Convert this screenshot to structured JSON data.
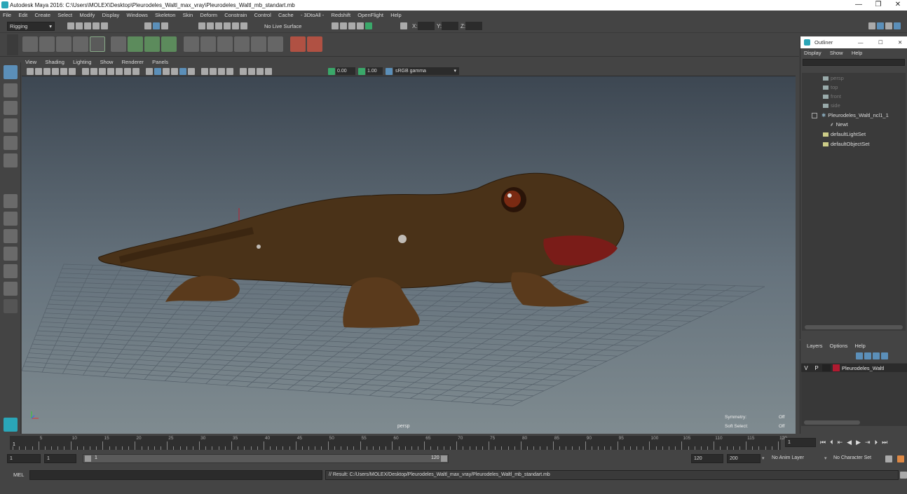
{
  "window": {
    "title": "Autodesk Maya 2016: C:\\Users\\MOLEX\\Desktop\\Pleurodeles_Waltl_max_vray\\Pleurodeles_Waltl_mb_standart.mb",
    "minimize": "—",
    "restore": "❐",
    "close": "✕"
  },
  "menu": [
    "File",
    "Edit",
    "Create",
    "Select",
    "Modify",
    "Display",
    "Windows",
    "Skeleton",
    "Skin",
    "Deform",
    "Constrain",
    "Control",
    "Cache",
    "- 3DtoAll -",
    "Redshift",
    "OpenFlight",
    "Help"
  ],
  "toolbar": {
    "mode": "Rigging",
    "live_surface": "No Live Surface",
    "x_label": "X:",
    "y_label": "Y:",
    "z_label": "Z:"
  },
  "viewport_menu": [
    "View",
    "Shading",
    "Lighting",
    "Show",
    "Renderer",
    "Panels"
  ],
  "viewport_toolbar": {
    "exposure": "0.00",
    "gamma": "1.00",
    "color_space": "sRGB gamma"
  },
  "viewport": {
    "camera": "persp",
    "symmetry_label": "Symmetry:",
    "symmetry_value": "Off",
    "soft_select_label": "Soft Select:",
    "soft_select_value": "Off"
  },
  "outliner": {
    "title": "Outliner",
    "menu": [
      "Display",
      "Show",
      "Help"
    ],
    "items": [
      "persp",
      "top",
      "front",
      "side",
      "Pleurodeles_Waltl_ncl1_1",
      "Newt",
      "defaultLightSet",
      "defaultObjectSet"
    ]
  },
  "layers": {
    "menu": [
      "Layers",
      "Options",
      "Help"
    ],
    "layer": {
      "v": "V",
      "p": "P",
      "name": "Pleurodeles_Waltl",
      "color": "#b01a30"
    }
  },
  "timeline": {
    "ticks": [
      "5",
      "10",
      "15",
      "20",
      "25",
      "30",
      "35",
      "40",
      "45",
      "50",
      "55",
      "60",
      "65",
      "70",
      "75",
      "80",
      "85",
      "90",
      "95",
      "100",
      "105",
      "110",
      "115",
      "120"
    ],
    "current_frame": "1",
    "frame_marker": "1"
  },
  "range": {
    "start": "1",
    "playback_start": "1",
    "slider_start": "1",
    "slider_end": "120",
    "playback_end": "120",
    "end": "200",
    "anim_layer": "No Anim Layer",
    "character_set": "No Character Set"
  },
  "command": {
    "label": "MEL",
    "result": "// Result: C:/Users/MOLEX/Desktop/Pleurodeles_Waltl_max_vray/Pleurodeles_Waltl_mb_standart.mb"
  },
  "colors": {
    "accent": "#2aa6b8",
    "layer": "#b01a30",
    "newt": "#4a3218"
  }
}
